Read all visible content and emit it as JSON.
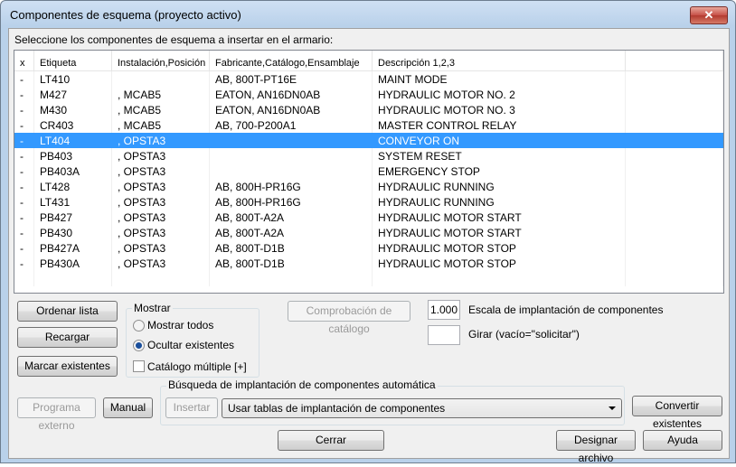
{
  "window": {
    "title": "Componentes de esquema (proyecto activo)",
    "close_glyph": "✕"
  },
  "prompt": "Seleccione los componentes de esquema a insertar en el armario:",
  "list": {
    "columns": [
      "x",
      "Etiqueta",
      "Instalación,Posición",
      "Fabricante,Catálogo,Ensamblaje",
      "Descripción 1,2,3",
      ""
    ],
    "rows": [
      [
        "-",
        "LT410",
        "",
        "AB, 800T-PT16E",
        "MAINT MODE",
        ""
      ],
      [
        "-",
        "M427",
        ", MCAB5",
        "EATON, AN16DN0AB",
        "HYDRAULIC MOTOR NO. 2",
        ""
      ],
      [
        "-",
        "M430",
        ", MCAB5",
        "EATON, AN16DN0AB",
        "HYDRAULIC MOTOR NO. 3",
        ""
      ],
      [
        "-",
        "CR403",
        ", MCAB5",
        "AB, 700-P200A1",
        "MASTER CONTROL RELAY",
        ""
      ],
      [
        "-",
        "LT404",
        ", OPSTA3",
        "",
        "CONVEYOR ON",
        ""
      ],
      [
        "-",
        "PB403",
        ", OPSTA3",
        "",
        "SYSTEM RESET",
        ""
      ],
      [
        "-",
        "PB403A",
        ", OPSTA3",
        "",
        "EMERGENCY STOP",
        ""
      ],
      [
        "-",
        "LT428",
        ", OPSTA3",
        "AB, 800H-PR16G",
        "HYDRAULIC RUNNING",
        ""
      ],
      [
        "-",
        "LT431",
        ", OPSTA3",
        "AB, 800H-PR16G",
        "HYDRAULIC RUNNING",
        ""
      ],
      [
        "-",
        "PB427",
        ", OPSTA3",
        "AB, 800T-A2A",
        "HYDRAULIC MOTOR START",
        ""
      ],
      [
        "-",
        "PB430",
        ", OPSTA3",
        "AB, 800T-A2A",
        "HYDRAULIC MOTOR START",
        ""
      ],
      [
        "-",
        "PB427A",
        ", OPSTA3",
        "AB, 800T-D1B",
        "HYDRAULIC MOTOR STOP",
        ""
      ],
      [
        "-",
        "PB430A",
        ", OPSTA3",
        "AB, 800T-D1B",
        "HYDRAULIC MOTOR STOP",
        ""
      ],
      [
        "",
        "",
        "",
        "",
        "",
        ""
      ]
    ],
    "selected_index": 4
  },
  "buttons": {
    "sort": "Ordenar lista",
    "reload": "Recargar",
    "mark_existing": "Marcar existentes",
    "catalog_check": "Comprobación de catálogo",
    "external_program": "Programa externo",
    "manual": "Manual",
    "insert": "Insertar",
    "convert_existing": "Convertir existentes",
    "close": "Cerrar",
    "designate_file": "Designar archivo",
    "help": "Ayuda"
  },
  "show_group": {
    "title": "Mostrar",
    "show_all": "Mostrar todos",
    "hide_existing": "Ocultar existentes",
    "selected": "hide_existing",
    "multi_catalog": "Catálogo múltiple [+]",
    "multi_catalog_checked": false
  },
  "scale": {
    "value": "1.000",
    "label": "Escala de implantación de componentes"
  },
  "rotate": {
    "value": "",
    "label": "Girar (vacío=\"solicitar\")"
  },
  "auto_group": {
    "title": "Búsqueda de implantación de componentes automática",
    "combo_value": "Usar tablas de implantación de componentes"
  },
  "colors": {
    "selection": "#3399ff",
    "dialog_bg": "#f0f0f0",
    "frame": "#b9d1ea"
  }
}
